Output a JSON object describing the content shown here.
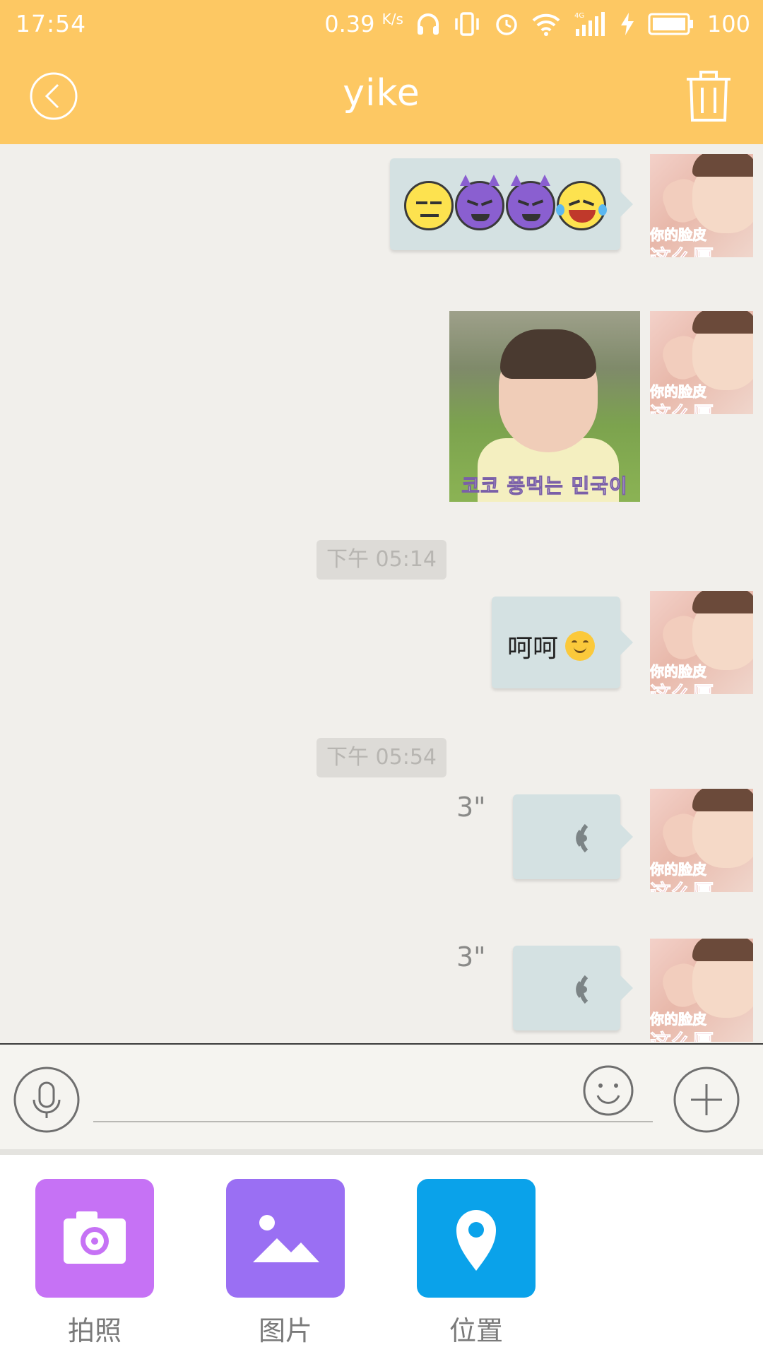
{
  "status_bar": {
    "time": "17:54",
    "net_speed": "0.39",
    "net_unit": "K/s",
    "battery": "100",
    "icons": [
      "headphones-icon",
      "vibrate-icon",
      "alarm-icon",
      "wifi-icon",
      "signal-4g-icon",
      "charging-icon",
      "battery-icon"
    ]
  },
  "header": {
    "title": "yike",
    "back_icon": "back-icon",
    "trash_icon": "trash-icon"
  },
  "messages": [
    {
      "type": "emoji",
      "sender": "me",
      "emojis": [
        "expressionless-face",
        "smiling-devil",
        "smiling-devil",
        "tears-of-joy"
      ]
    },
    {
      "type": "image",
      "sender": "me",
      "caption": "코코 풍먹는 민국이"
    },
    {
      "type": "timestamp",
      "text": "下午 05:14"
    },
    {
      "type": "text",
      "sender": "me",
      "text": "呵呵",
      "emoji": "smiling-face"
    },
    {
      "type": "timestamp",
      "text": "下午 05:54"
    },
    {
      "type": "voice",
      "sender": "me",
      "duration": "3\""
    },
    {
      "type": "voice",
      "sender": "me",
      "duration": "3\""
    }
  ],
  "avatar": {
    "caption_line1": "你的脸皮",
    "caption_line2": "这么厚"
  },
  "input": {
    "value": "",
    "placeholder": ""
  },
  "attachments": [
    {
      "label": "拍照",
      "icon": "camera-icon",
      "color": "#c672f5"
    },
    {
      "label": "图片",
      "icon": "picture-icon",
      "color": "#9a6ff3"
    },
    {
      "label": "位置",
      "icon": "location-icon",
      "color": "#0aa2ea"
    }
  ],
  "colors": {
    "header": "#fdc863",
    "bubble": "#d4e1e2",
    "chat_background": "#f1efeb"
  }
}
